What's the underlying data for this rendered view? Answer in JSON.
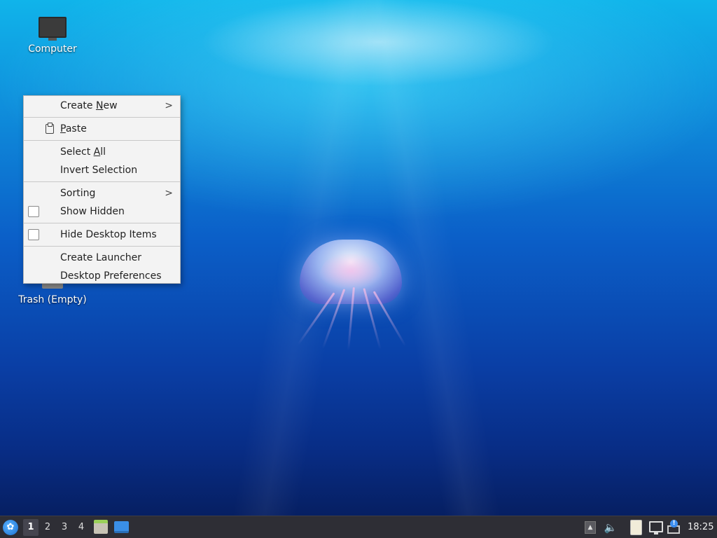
{
  "desktop": {
    "icons": [
      {
        "label": "Computer",
        "icon": "computer-icon"
      },
      {
        "label": "Trash (Empty)",
        "icon": "trash-icon"
      }
    ]
  },
  "context_menu": {
    "items": [
      {
        "label": "Create New",
        "mnemonic": "N",
        "submenu": true
      },
      {
        "label": "Paste",
        "mnemonic": "P",
        "icon": "paste-icon"
      },
      {
        "label": "Select All",
        "mnemonic": "A"
      },
      {
        "label": "Invert Selection"
      },
      {
        "label": "Sorting",
        "submenu": true
      },
      {
        "label": "Show Hidden",
        "checkbox": true,
        "checked": false
      },
      {
        "label": "Hide Desktop Items",
        "checkbox": true,
        "checked": false
      },
      {
        "label": "Create Launcher"
      },
      {
        "label": "Desktop Preferences"
      }
    ],
    "submenu_glyph": ">"
  },
  "taskbar": {
    "start_icon": "start-menu-icon",
    "workspaces": [
      "1",
      "2",
      "3",
      "4"
    ],
    "active_workspace": "1",
    "launchers": [
      {
        "icon": "file-manager-icon"
      },
      {
        "icon": "show-desktop-icon"
      }
    ],
    "tray": [
      "tray-expand-icon",
      "volume-icon",
      "clipboard-icon",
      "network-icon",
      "update-notifier-icon"
    ],
    "clock": "18:25"
  }
}
